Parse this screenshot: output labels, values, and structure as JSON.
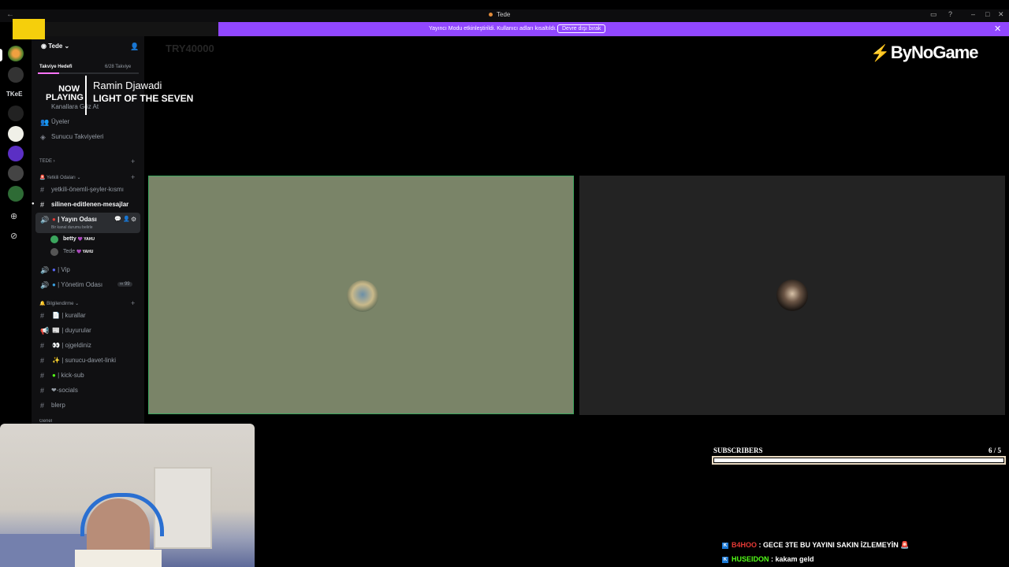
{
  "window": {
    "title": "Tede",
    "back_glyph": "←"
  },
  "banner": {
    "text": "Yayıncı Modu etkinleştirildi. Kullanıcı adları kısaltıldı.",
    "button_label": "Devre dışı bırak",
    "close_glyph": "✕"
  },
  "overlay": {
    "now_playing_label": "NOW PLAYING",
    "artist": "Ramin Djawadi",
    "song": "LIGHT OF THE SEVEN",
    "goal_text": "TRY40000",
    "brand": "ByNoGame"
  },
  "rail": {
    "servers": [
      "TKeE"
    ]
  },
  "server": {
    "name": "Tede",
    "boost": {
      "label": "Takviye Hedefi",
      "progress": "6/28 Takviye",
      "fraction": 0.21
    },
    "top_links": [
      "Kanallara Göz At",
      "Üyeler",
      "Sunucu Takviyeleri"
    ],
    "section_label": "TEDE",
    "categories": [
      {
        "label": "Yetkili Odaları",
        "icon": "🚨"
      },
      {
        "label": "Bilgilendirme",
        "icon": "🔔"
      },
      {
        "label": "Genel"
      }
    ],
    "channels": {
      "staff_text": "yetkili-önemli-şeyler-kısmı",
      "edited_text": "silinen-editlenen-mesajlar",
      "stream_voice": "| Yayın Odası",
      "stream_status": "Bir kanal durumu belirle",
      "users": [
        {
          "name": "betty",
          "badge": "YAHU"
        },
        {
          "name": "Tede",
          "badge": "YAHU"
        }
      ],
      "vip": "| Vip",
      "admin": "| Yönetim Odası",
      "admin_limit": "∞ 99",
      "info": [
        "| kurallar",
        "| duyurular",
        "| ojgeldiniz",
        "| sunucu-davet-linki",
        "| kick-sub",
        "❤-socials",
        "blerp"
      ]
    }
  },
  "subscribers": {
    "label": "SUBSCRIBERS",
    "count": "6 / 5",
    "fraction": 1.0
  },
  "chat": [
    {
      "user": "B4HOO",
      "message": ": GECE 3TE BU YAYINI SAKIN İZLEMEYİN",
      "color": "#e53935"
    },
    {
      "user": "HUSEIDON",
      "message": ": kakam geld",
      "color": "#53fc18"
    }
  ],
  "colors": {
    "banner": "#9147ff",
    "speaking_border": "#3ba55d",
    "overlay_yellow": "#f5cf0c"
  }
}
